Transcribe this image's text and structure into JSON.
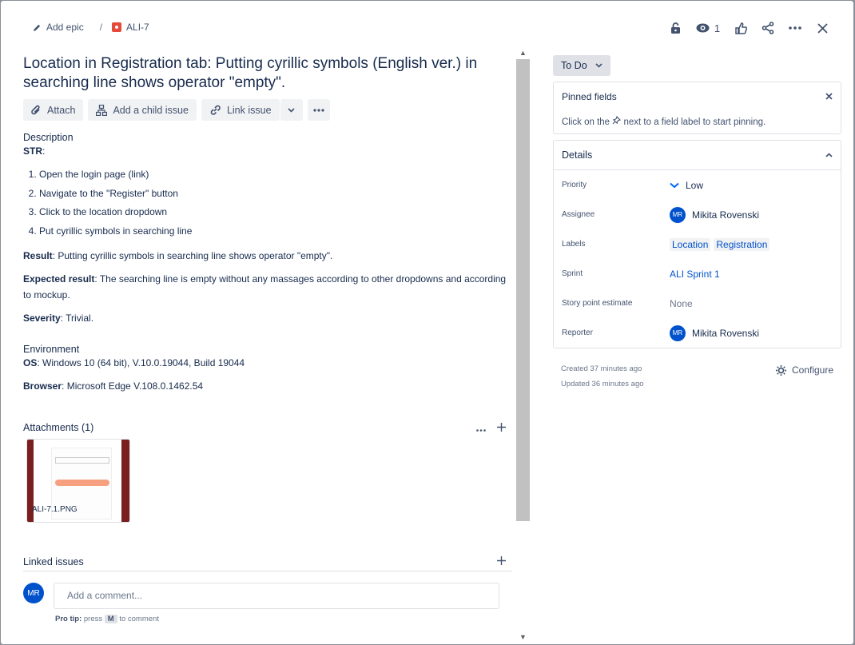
{
  "header": {
    "add_epic": "Add epic",
    "separator": "/",
    "issue_key": "ALI-7",
    "watch_count": "1"
  },
  "issue": {
    "title": "Location in Registration tab: Putting cyrillic symbols (English ver.) in searching line shows operator \"empty\"."
  },
  "toolbar": {
    "attach": "Attach",
    "add_child": "Add a child issue",
    "link_issue": "Link issue"
  },
  "description": {
    "heading": "Description",
    "str_label": "STR",
    "str_suffix": ":",
    "steps": [
      "Open the login page (link)",
      "Navigate to the \"Register\" button",
      "Click to the location dropdown",
      "Put cyrillic symbols in searching line"
    ],
    "result_label": "Result",
    "result_text": ": Putting cyrillic symbols in searching line shows operator \"empty\".",
    "expected_label": "Expected result",
    "expected_text": ": The searching line is empty without any massages according to other dropdowns and according to mockup.",
    "severity_label": "Severity",
    "severity_text": ": Trivial."
  },
  "environment": {
    "heading": "Environment",
    "os_label": "OS",
    "os_text": ": Windows 10 (64 bit), V.10.0.19044, Build 19044",
    "browser_label": "Browser",
    "browser_text": ": Microsoft Edge V.108.0.1462.54"
  },
  "attachments": {
    "heading": "Attachments (1)",
    "file_name": "ALI-7.1.PNG"
  },
  "linked": {
    "heading": "Linked issues"
  },
  "comment": {
    "avatar": "MR",
    "placeholder": "Add a comment...",
    "protip_label": "Pro tip:",
    "protip_press": "press",
    "protip_key": "M",
    "protip_suffix": "to comment"
  },
  "status": {
    "label": "To Do"
  },
  "pinned": {
    "title": "Pinned fields",
    "text_before": "Click on the",
    "text_after": "next to a field label to start pinning."
  },
  "details": {
    "heading": "Details",
    "rows": [
      {
        "label": "Priority",
        "value": "Low"
      },
      {
        "label": "Assignee",
        "value": "Mikita Rovenski",
        "avatar": "MR"
      },
      {
        "label": "Labels",
        "values": [
          "Location",
          "Registration"
        ]
      },
      {
        "label": "Sprint",
        "value": "ALI Sprint 1"
      },
      {
        "label": "Story point estimate",
        "value": "None"
      },
      {
        "label": "Reporter",
        "value": "Mikita Rovenski",
        "avatar": "MR"
      }
    ]
  },
  "meta": {
    "created": "Created 37 minutes ago",
    "updated": "Updated 36 minutes ago",
    "configure": "Configure"
  },
  "colors": {
    "accent": "#0052cc",
    "bug": "#e5493a",
    "priority_low": "#0065ff"
  }
}
